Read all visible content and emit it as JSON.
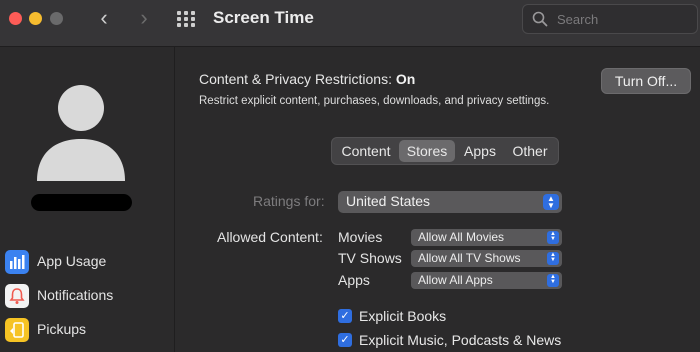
{
  "window": {
    "title": "Screen Time"
  },
  "search": {
    "placeholder": "Search"
  },
  "sidebar": {
    "items": [
      {
        "label": "App Usage",
        "icon": "app-usage-icon",
        "color": "#3b82f0"
      },
      {
        "label": "Notifications",
        "icon": "notifications-icon",
        "color": "#f05a4f"
      },
      {
        "label": "Pickups",
        "icon": "pickups-icon",
        "color": "#f6c324"
      }
    ]
  },
  "main": {
    "header_label": "Content & Privacy Restrictions:",
    "header_status": "On",
    "description": "Restrict explicit content, purchases, downloads, and privacy settings.",
    "turn_off_label": "Turn Off...",
    "tabs": [
      {
        "label": "Content"
      },
      {
        "label": "Stores",
        "selected": true
      },
      {
        "label": "Apps"
      },
      {
        "label": "Other"
      }
    ],
    "ratings_label": "Ratings for:",
    "ratings_value": "United States",
    "allowed_label": "Allowed Content:",
    "allowed": [
      {
        "label": "Movies",
        "value": "Allow All Movies"
      },
      {
        "label": "TV Shows",
        "value": "Allow All TV Shows"
      },
      {
        "label": "Apps",
        "value": "Allow All Apps"
      }
    ],
    "checkboxes": [
      {
        "label": "Explicit Books",
        "checked": true
      },
      {
        "label": "Explicit Music, Podcasts & News",
        "checked": true
      }
    ]
  }
}
